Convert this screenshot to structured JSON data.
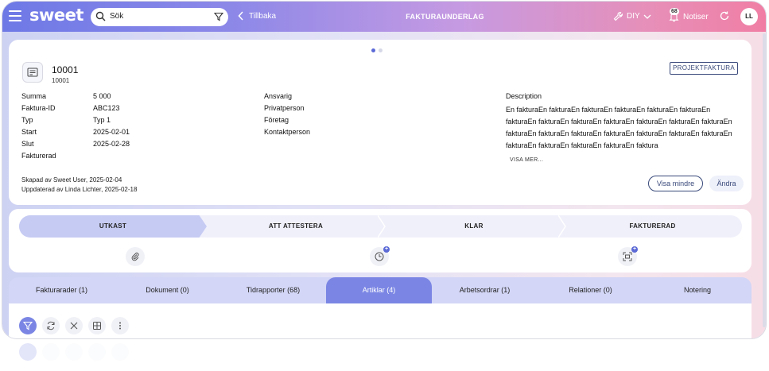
{
  "topbar": {
    "logo": "sweet",
    "search_placeholder": "Sök",
    "back_label": "Tillbaka",
    "page_title": "FAKTURAUNDERLAG",
    "diy_label": "DIY",
    "notifications_label": "Notiser",
    "notifications_count": "68",
    "avatar_initials": "LL"
  },
  "record": {
    "id": "10001",
    "id_sub": "10001",
    "project_button": "PROJEKTFAKTURA",
    "fields_left": [
      {
        "label": "Summa",
        "value": "5 000"
      },
      {
        "label": "Faktura-ID",
        "value": "ABC123"
      },
      {
        "label": "Typ",
        "value": "Typ 1"
      },
      {
        "label": "Start",
        "value": "2025-02-01"
      },
      {
        "label": "Slut",
        "value": "2025-02-28"
      },
      {
        "label": "Fakturerad",
        "value": ""
      }
    ],
    "fields_middle": [
      "Ansvarig",
      "Privatperson",
      "Företag",
      "Kontaktperson"
    ],
    "description_label": "Description",
    "description_text": "En fakturaEn fakturaEn fakturaEn fakturaEn fakturaEn fakturaEn fakturaEn fakturaEn fakturaEn fakturaEn fakturaEn fakturaEn fakturaEn fakturaEn fakturaEn fakturaEn fakturaEn fakturaEn fakturaEn fakturaEn fakturaEn fakturaEn fakturaEn fakturaEn faktura",
    "show_more": "VISA MER...",
    "created": "Skapad av Sweet User, 2025-02-04",
    "updated": "Uppdaterad av Linda Lichter, 2025-02-18",
    "show_less_button": "Visa mindre",
    "edit_button": "Ändra"
  },
  "stepper": {
    "steps": [
      "UTKAST",
      "ATT ATTESTERA",
      "KLAR",
      "FAKTURERAD"
    ],
    "active_index": 0
  },
  "tabs": {
    "items": [
      "Fakturarader (1)",
      "Dokument (0)",
      "Tidrapporter (68)",
      "Artiklar (4)",
      "Arbetsordrar (1)",
      "Relationer (0)",
      "Notering"
    ],
    "active_index": 3
  },
  "toolbar_icons": [
    "filter-icon",
    "refresh-icon",
    "close-icon",
    "columns-icon",
    "more-icon"
  ],
  "colors": {
    "accent": "#7b86e4",
    "primary_dark": "#39497a",
    "step_active": "#c6cbf3"
  }
}
